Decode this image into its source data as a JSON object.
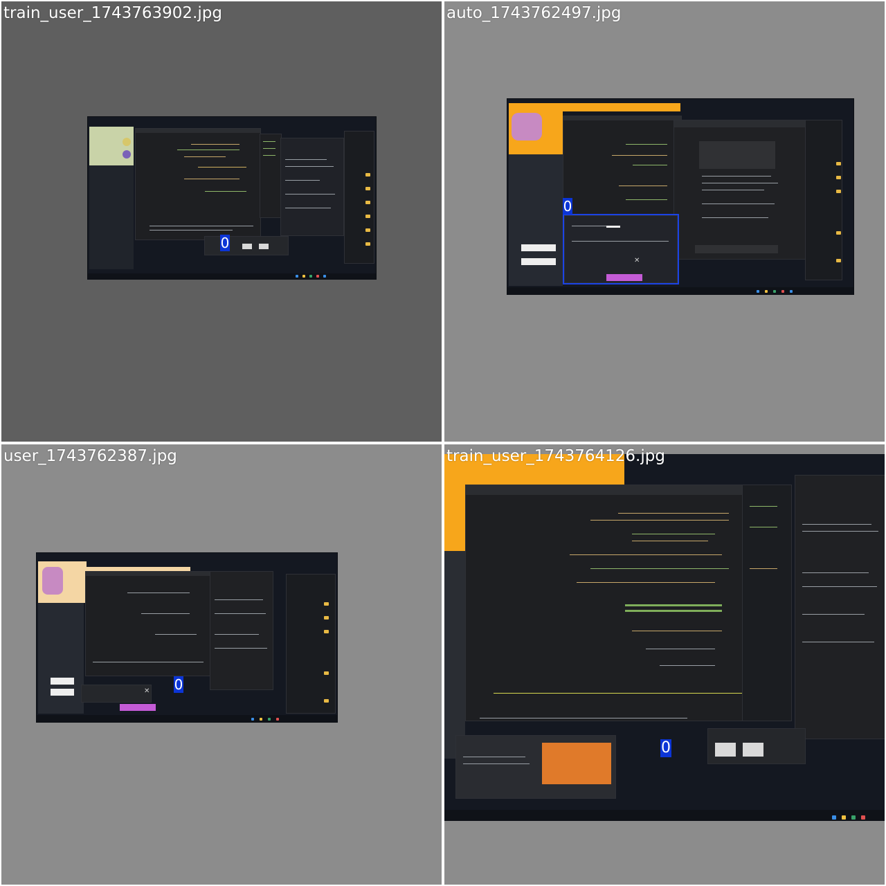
{
  "grid": {
    "cells": [
      {
        "caption": "train_user_1743763902.jpg",
        "marker": "0",
        "background": "#5f5f5f"
      },
      {
        "caption": "auto_1743762497.jpg",
        "marker": "0",
        "background": "#8c8c8c"
      },
      {
        "caption": "user_1743762387.jpg",
        "marker": "0",
        "background": "#8c8c8c"
      },
      {
        "caption": "train_user_1743764126.jpg",
        "marker": "0",
        "background": "#8c8c8c"
      }
    ]
  },
  "colors": {
    "marker": "#0c35d6",
    "selection": "#1b43e6",
    "desktop": "#141821",
    "window": "#1e1f22",
    "folder": "#e8b944"
  },
  "icons": [
    "folder-icon",
    "close-icon"
  ]
}
